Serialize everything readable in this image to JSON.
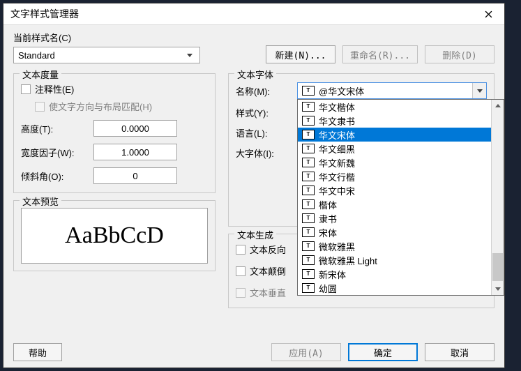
{
  "title": "文字样式管理器",
  "style_name_label": "当前样式名(C)",
  "style_name_value": "Standard",
  "buttons": {
    "new": "新建(N)...",
    "rename": "重命名(R)...",
    "delete": "删除(D)",
    "help": "帮助",
    "apply": "应用(A)",
    "ok": "确定",
    "cancel": "取消"
  },
  "measure": {
    "group": "文本度量",
    "annotative": "注释性(E)",
    "match_layout": "使文字方向与布局匹配(H)",
    "height_label": "高度(T):",
    "height_value": "0.0000",
    "width_label": "宽度因子(W):",
    "width_value": "1.0000",
    "oblique_label": "倾斜角(O):",
    "oblique_value": "0"
  },
  "font": {
    "group": "文本字体",
    "name_label": "名称(M):",
    "name_value": "@华文宋体",
    "style_label": "样式(Y):",
    "lang_label": "语言(L):",
    "bigfont_label": "大字体(I):",
    "options": [
      "华文楷体",
      "华文隶书",
      "华文宋体",
      "华文细黑",
      "华文新魏",
      "华文行楷",
      "华文中宋",
      "楷体",
      "隶书",
      "宋体",
      "微软雅黑",
      "微软雅黑 Light",
      "新宋体",
      "幼圆"
    ],
    "selected_index": 2
  },
  "preview": {
    "group": "文本预览",
    "sample": "AaBbCcD"
  },
  "gen": {
    "group": "文本生成",
    "reverse": "文本反向",
    "upside": "文本颠倒",
    "vertical": "文本垂直"
  }
}
